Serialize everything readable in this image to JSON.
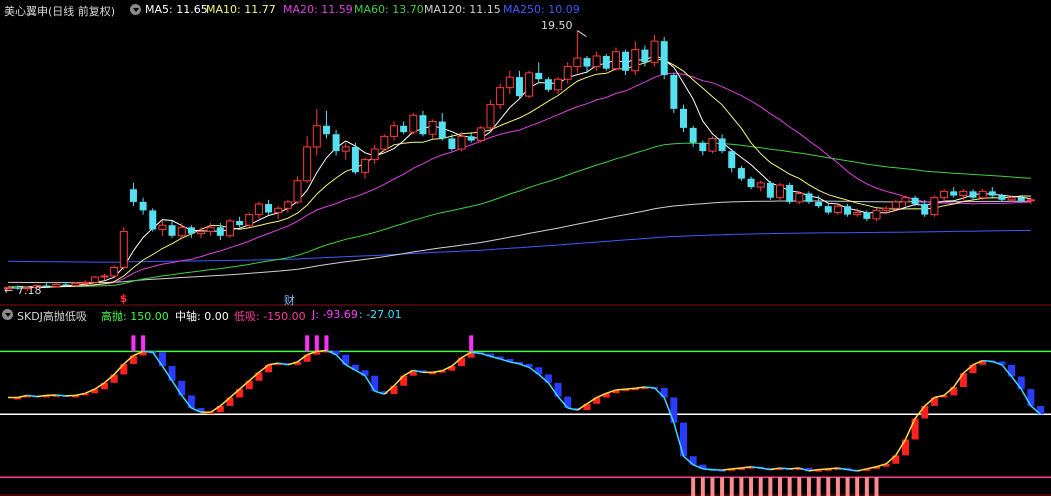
{
  "main_panel": {
    "title": "美心翼申(日线 前复权)",
    "ma_legend": [
      {
        "label": "MA5: 11.65",
        "color": "#ffffff"
      },
      {
        "label": "MA10: 11.77",
        "color": "#f7f77a"
      },
      {
        "label": "MA20: 11.59",
        "color": "#e040e0"
      },
      {
        "label": "MA60: 13.70",
        "color": "#40d040"
      },
      {
        "label": "MA120: 11.15",
        "color": "#d0d0d0"
      },
      {
        "label": "MA250: 10.09",
        "color": "#3a5cff"
      }
    ],
    "high_marker": "19.50",
    "low_marker": "7.18",
    "event_markers": [
      {
        "text": "$",
        "color": "#ff3030",
        "index": 12
      },
      {
        "text": "财",
        "color": "#7fbfff",
        "index": 29
      }
    ]
  },
  "sub_panel": {
    "title": "SKDJ高抛低吸",
    "legend": [
      {
        "label": "高抛: 150.00",
        "color": "#40ff40"
      },
      {
        "label": "中轴: 0.00",
        "color": "#ffffff"
      },
      {
        "label": "低吸: -150.00",
        "color": "#ff3a9a"
      },
      {
        "label": "J: -93.69",
        "color": "#ff40ff"
      },
      {
        "label": ": -27.01",
        "color": "#40e0ff"
      }
    ]
  },
  "colors": {
    "up": "#ff3b3b",
    "down": "#54e0f0",
    "ma5": "#ffffff",
    "ma10": "#f7f77a",
    "ma20": "#e040e0",
    "ma60": "#40d040",
    "ma120": "#d0d0d0",
    "ma250": "#3a5cff",
    "high_line": "#40ff40",
    "mid_line": "#ffffff",
    "low_line": "#ff3a9a"
  },
  "chart_data": [
    {
      "type": "candlestick",
      "price_range": [
        7.0,
        20.0
      ],
      "candles": [
        [
          7.3,
          7.4,
          7.2,
          7.35
        ],
        [
          7.35,
          7.45,
          7.25,
          7.3
        ],
        [
          7.3,
          7.4,
          7.18,
          7.35
        ],
        [
          7.35,
          7.5,
          7.3,
          7.45
        ],
        [
          7.45,
          7.55,
          7.35,
          7.4
        ],
        [
          7.4,
          7.55,
          7.35,
          7.5
        ],
        [
          7.5,
          7.6,
          7.4,
          7.45
        ],
        [
          7.45,
          7.6,
          7.4,
          7.55
        ],
        [
          7.55,
          7.7,
          7.5,
          7.6
        ],
        [
          7.6,
          7.9,
          7.55,
          7.85
        ],
        [
          7.85,
          8.0,
          7.7,
          7.9
        ],
        [
          7.9,
          8.4,
          7.85,
          8.3
        ],
        [
          8.3,
          10.2,
          8.2,
          10.0
        ],
        [
          12.0,
          12.3,
          11.2,
          11.4
        ],
        [
          11.4,
          11.6,
          10.8,
          11.0
        ],
        [
          11.0,
          11.1,
          10.0,
          10.1
        ],
        [
          10.1,
          10.5,
          9.8,
          10.3
        ],
        [
          10.3,
          10.5,
          9.7,
          9.8
        ],
        [
          9.8,
          10.4,
          9.7,
          10.2
        ],
        [
          10.2,
          10.3,
          9.7,
          9.9
        ],
        [
          9.9,
          10.2,
          9.7,
          10.0
        ],
        [
          10.0,
          10.4,
          9.8,
          10.2
        ],
        [
          10.2,
          10.4,
          9.6,
          9.8
        ],
        [
          9.8,
          10.6,
          9.7,
          10.5
        ],
        [
          10.5,
          10.7,
          10.2,
          10.3
        ],
        [
          10.3,
          10.9,
          10.2,
          10.8
        ],
        [
          10.8,
          11.4,
          10.6,
          11.3
        ],
        [
          11.3,
          11.5,
          10.8,
          10.9
        ],
        [
          10.9,
          11.2,
          10.6,
          11.1
        ],
        [
          11.1,
          11.5,
          10.9,
          11.4
        ],
        [
          11.4,
          12.6,
          11.3,
          12.4
        ],
        [
          12.4,
          14.5,
          12.3,
          14.0
        ],
        [
          14.0,
          15.8,
          13.6,
          15.0
        ],
        [
          15.0,
          15.7,
          14.4,
          14.6
        ],
        [
          14.6,
          14.8,
          13.6,
          13.8
        ],
        [
          13.8,
          14.2,
          13.4,
          14.0
        ],
        [
          14.0,
          14.2,
          12.7,
          12.8
        ],
        [
          12.8,
          13.5,
          12.5,
          13.4
        ],
        [
          13.4,
          14.1,
          13.2,
          13.9
        ],
        [
          13.9,
          14.6,
          13.8,
          14.5
        ],
        [
          14.5,
          15.2,
          14.3,
          15.0
        ],
        [
          15.0,
          15.2,
          14.6,
          14.7
        ],
        [
          14.7,
          15.6,
          14.6,
          15.5
        ],
        [
          15.5,
          15.7,
          14.5,
          14.6
        ],
        [
          14.6,
          15.3,
          14.4,
          15.2
        ],
        [
          15.2,
          15.6,
          14.3,
          14.4
        ],
        [
          14.4,
          14.6,
          13.8,
          13.9
        ],
        [
          13.9,
          14.7,
          13.8,
          14.5
        ],
        [
          14.5,
          14.7,
          14.2,
          14.3
        ],
        [
          14.3,
          15.0,
          14.2,
          14.9
        ],
        [
          14.9,
          16.2,
          14.8,
          16.0
        ],
        [
          16.0,
          17.0,
          15.8,
          16.8
        ],
        [
          16.8,
          17.6,
          16.5,
          17.3
        ],
        [
          17.3,
          17.6,
          16.3,
          16.4
        ],
        [
          16.4,
          17.6,
          16.3,
          17.5
        ],
        [
          17.5,
          18.0,
          17.0,
          17.2
        ],
        [
          17.2,
          17.3,
          16.6,
          16.7
        ],
        [
          16.7,
          17.3,
          16.5,
          17.2
        ],
        [
          17.2,
          18.0,
          17.0,
          17.8
        ],
        [
          17.8,
          19.5,
          17.5,
          18.2
        ],
        [
          18.2,
          18.3,
          17.5,
          17.8
        ],
        [
          17.8,
          18.5,
          17.6,
          18.3
        ],
        [
          18.3,
          18.4,
          17.6,
          17.7
        ],
        [
          17.7,
          18.7,
          17.6,
          18.5
        ],
        [
          18.5,
          18.6,
          17.4,
          17.6
        ],
        [
          17.6,
          19.0,
          17.4,
          18.6
        ],
        [
          18.6,
          18.8,
          17.8,
          18.0
        ],
        [
          18.0,
          19.3,
          17.8,
          19.0
        ],
        [
          19.0,
          19.2,
          17.2,
          17.4
        ],
        [
          17.4,
          17.5,
          15.6,
          15.8
        ],
        [
          15.8,
          16.0,
          14.7,
          14.9
        ],
        [
          14.9,
          15.0,
          14.0,
          14.2
        ],
        [
          14.2,
          14.3,
          13.6,
          13.8
        ],
        [
          13.8,
          14.5,
          13.7,
          14.4
        ],
        [
          14.4,
          14.6,
          13.7,
          13.8
        ],
        [
          13.8,
          13.9,
          12.8,
          13.0
        ],
        [
          13.0,
          13.1,
          12.4,
          12.5
        ],
        [
          12.5,
          12.6,
          12.0,
          12.1
        ],
        [
          12.1,
          12.4,
          11.9,
          12.3
        ],
        [
          12.3,
          12.4,
          11.5,
          11.6
        ],
        [
          11.6,
          12.3,
          11.5,
          12.2
        ],
        [
          12.2,
          12.3,
          11.3,
          11.4
        ],
        [
          11.4,
          11.9,
          11.3,
          11.8
        ],
        [
          11.8,
          11.9,
          11.3,
          11.4
        ],
        [
          11.4,
          11.7,
          11.1,
          11.2
        ],
        [
          11.2,
          11.3,
          10.8,
          10.9
        ],
        [
          10.9,
          11.3,
          10.8,
          11.2
        ],
        [
          11.2,
          11.3,
          10.7,
          10.8
        ],
        [
          10.8,
          11.1,
          10.7,
          10.9
        ],
        [
          10.9,
          11.0,
          10.5,
          10.6
        ],
        [
          10.6,
          11.1,
          10.5,
          11.0
        ],
        [
          11.0,
          11.2,
          10.8,
          11.1
        ],
        [
          11.1,
          11.5,
          11.0,
          11.4
        ],
        [
          11.4,
          11.7,
          11.2,
          11.6
        ],
        [
          11.6,
          11.7,
          11.2,
          11.3
        ],
        [
          11.3,
          11.5,
          10.7,
          10.8
        ],
        [
          10.8,
          11.7,
          10.7,
          11.6
        ],
        [
          11.6,
          12.0,
          11.4,
          11.9
        ],
        [
          11.9,
          12.1,
          11.6,
          11.7
        ],
        [
          11.7,
          12.0,
          11.5,
          11.9
        ],
        [
          11.9,
          12.0,
          11.5,
          11.6
        ],
        [
          11.6,
          12.0,
          11.5,
          11.9
        ],
        [
          11.9,
          12.1,
          11.6,
          11.7
        ],
        [
          11.7,
          11.8,
          11.4,
          11.5
        ],
        [
          11.5,
          11.7,
          11.4,
          11.6
        ],
        [
          11.6,
          11.7,
          11.4,
          11.45
        ],
        [
          11.45,
          11.6,
          11.3,
          11.5
        ]
      ]
    },
    {
      "type": "bar",
      "y_range": [
        -190,
        220
      ],
      "j_line": [
        40,
        40,
        45,
        42,
        45,
        46,
        44,
        45,
        50,
        60,
        75,
        95,
        120,
        140,
        150,
        148,
        115,
        80,
        45,
        15,
        5,
        5,
        20,
        40,
        60,
        80,
        100,
        118,
        122,
        118,
        125,
        142,
        150,
        152,
        142,
        118,
        105,
        92,
        55,
        48,
        68,
        92,
        105,
        100,
        100,
        104,
        115,
        135,
        148,
        145,
        138,
        132,
        125,
        120,
        112,
        95,
        75,
        42,
        15,
        10,
        25,
        40,
        50,
        58,
        60,
        62,
        65,
        63,
        40,
        -20,
        -100,
        -120,
        -130,
        -132,
        -133,
        -130,
        -128,
        -125,
        -128,
        -132,
        -128,
        -130,
        -128,
        -135,
        -132,
        -130,
        -128,
        -132,
        -135,
        -130,
        -125,
        -118,
        -98,
        -60,
        -10,
        20,
        40,
        45,
        65,
        98,
        118,
        128,
        126,
        118,
        90,
        60,
        20,
        0
      ]
    }
  ]
}
